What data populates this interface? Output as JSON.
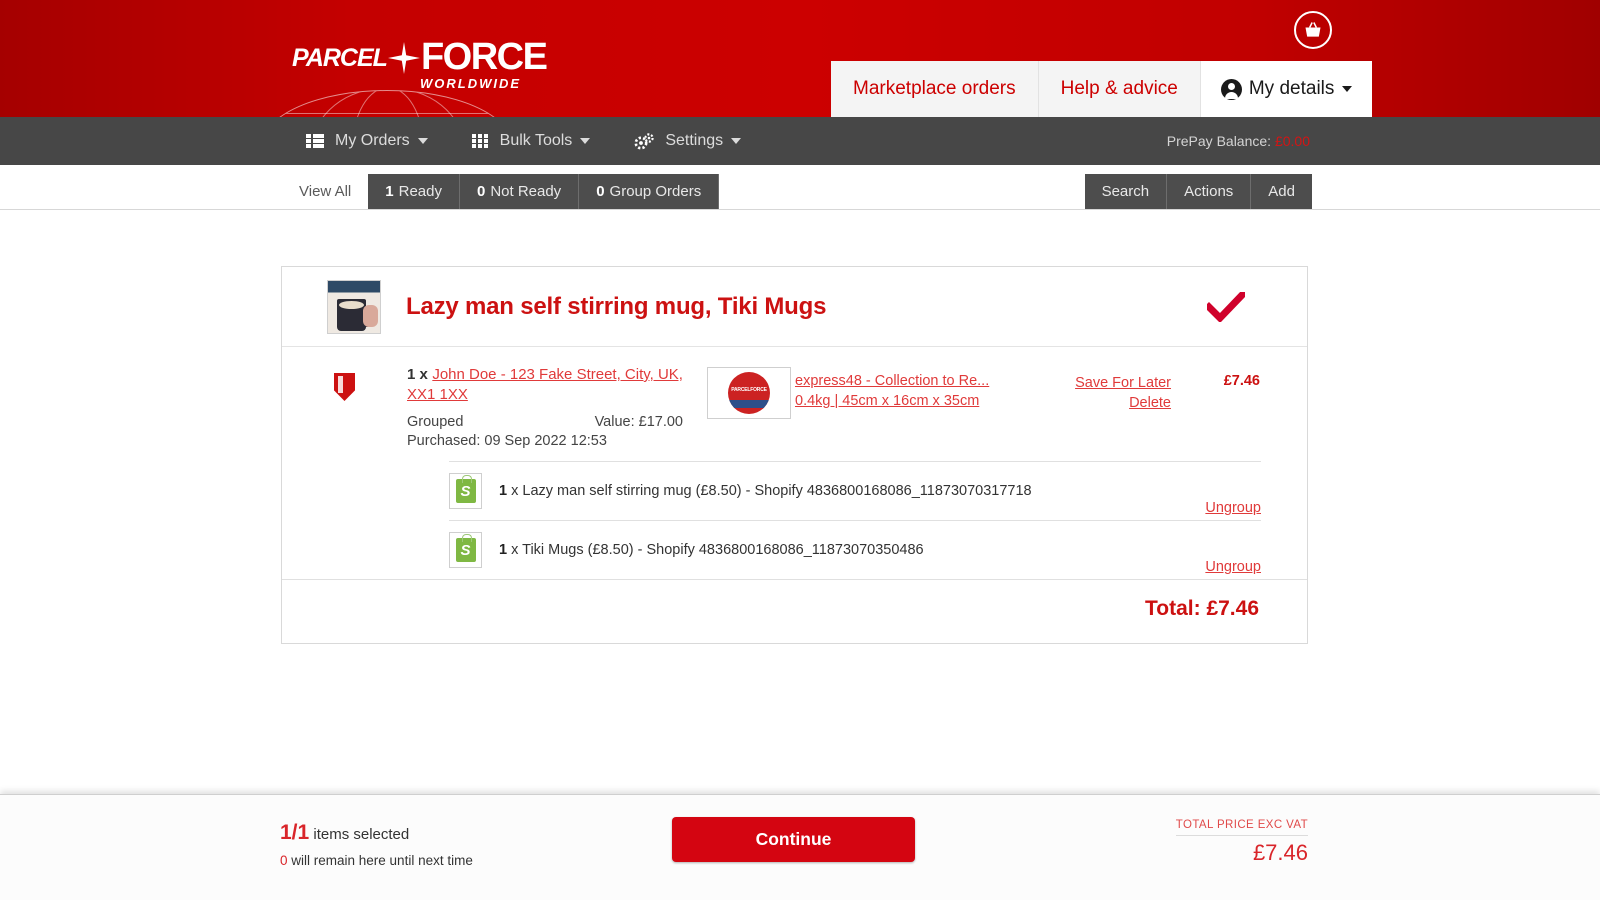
{
  "brand": {
    "logo_parcel": "PARCEL",
    "logo_force": "FORCE",
    "logo_worldwide": "WORLDWIDE",
    "accent_red": "#cc0000",
    "link_red": "#e03a3a",
    "dark_nav": "#474747"
  },
  "header": {
    "basket_icon": "basket-icon",
    "tabs": [
      {
        "label": "Marketplace orders",
        "active": false
      },
      {
        "label": "Help & advice",
        "active": false
      },
      {
        "label": "My details",
        "active": true,
        "icon": "user-circle-icon",
        "caret": "chevron-down-icon"
      }
    ]
  },
  "mainnav": {
    "items": [
      {
        "label": "My Orders",
        "icon": "list-icon"
      },
      {
        "label": "Bulk Tools",
        "icon": "grid-icon"
      },
      {
        "label": "Settings",
        "icon": "gears-icon"
      }
    ],
    "prepay_label": "PrePay Balance:",
    "prepay_amount": "£0.00"
  },
  "tabstrip": {
    "view_all": "View All",
    "tabs": [
      {
        "count": "1",
        "label": "Ready"
      },
      {
        "count": "0",
        "label": "Not Ready"
      },
      {
        "count": "0",
        "label": "Group Orders"
      }
    ],
    "actions": [
      {
        "label": "Search"
      },
      {
        "label": "Actions"
      },
      {
        "label": "Add"
      }
    ]
  },
  "order": {
    "title": "Lazy man self stirring mug, Tiki Mugs",
    "thumbnail": "product-thumbnail",
    "status_icon": "check-mark-icon",
    "shield_icon": "shield-icon",
    "quantity": "1 x",
    "address": "John Doe - 123 Fake Street, City, UK, XX1 1XX",
    "grouped_label": "Grouped",
    "value_label": "Value: £17.00",
    "purchased_label": "Purchased: 09 Sep 2022 12:53",
    "service_logo": "parcelforce-logo-icon",
    "service_name": "express48 - Collection to Re...",
    "service_dims": "0.4kg | 45cm x 16cm x 35cm",
    "save_for_later": "Save For Later",
    "delete": "Delete",
    "price": "£7.46",
    "sub_items": [
      {
        "icon": "shopify-icon",
        "qty": "1",
        "text": "x Lazy man self stirring mug (£8.50) - Shopify 4836800168086_11873070317718",
        "ungroup": "Ungroup"
      },
      {
        "icon": "shopify-icon",
        "qty": "1",
        "text": "x Tiki Mugs (£8.50) - Shopify 4836800168086_11873070350486",
        "ungroup": "Ungroup"
      }
    ],
    "total": "Total: £7.46"
  },
  "footer": {
    "selected_count": "1/1",
    "selected_label": " items selected",
    "remain_count": "0",
    "remain_label": " will remain here until next time",
    "continue_label": "Continue",
    "total_label": "TOTAL PRICE EXC VAT",
    "total_value": "£7.46"
  }
}
